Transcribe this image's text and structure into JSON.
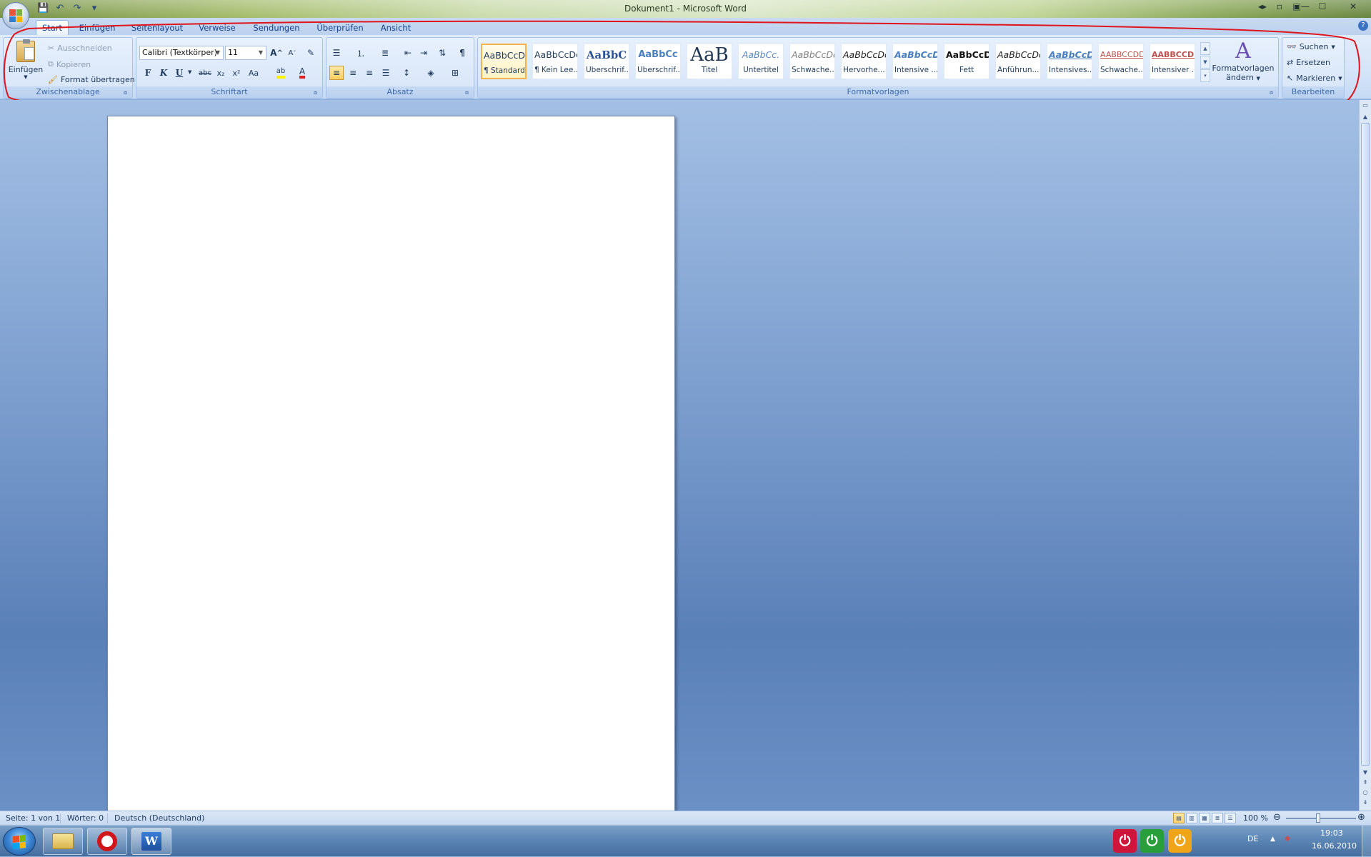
{
  "window": {
    "title": "Dokument1 - Microsoft Word"
  },
  "tabs": [
    {
      "label": "Start",
      "active": true
    },
    {
      "label": "Einfügen",
      "active": false
    },
    {
      "label": "Seitenlayout",
      "active": false
    },
    {
      "label": "Verweise",
      "active": false
    },
    {
      "label": "Sendungen",
      "active": false
    },
    {
      "label": "Überprüfen",
      "active": false
    },
    {
      "label": "Ansicht",
      "active": false
    }
  ],
  "clipboard": {
    "paste_label": "Einfügen",
    "cut_label": "Ausschneiden",
    "copy_label": "Kopieren",
    "format_painter_label": "Format übertragen",
    "group_label": "Zwischenablage"
  },
  "font": {
    "font_name": "Calibri (Textkörper)",
    "font_size": "11",
    "bold": "F",
    "italic": "K",
    "underline": "U",
    "strikethrough": "abc",
    "subscript": "x₂",
    "superscript": "x²",
    "case": "Aa",
    "grow": "A",
    "shrink": "A",
    "group_label": "Schriftart"
  },
  "paragraph": {
    "pilcrow": "¶",
    "group_label": "Absatz"
  },
  "styles": {
    "items": [
      {
        "sample": "AaBbCcDc",
        "name": "¶ Standard"
      },
      {
        "sample": "AaBbCcDc",
        "name": "¶ Kein Lee..."
      },
      {
        "sample": "AaBbC",
        "name": "Überschrif..."
      },
      {
        "sample": "AaBbCc",
        "name": "Überschrif..."
      },
      {
        "sample": "AaB",
        "name": "Titel"
      },
      {
        "sample": "AaBbCc.",
        "name": "Untertitel"
      },
      {
        "sample": "AaBbCcDc",
        "name": "Schwache..."
      },
      {
        "sample": "AaBbCcDc",
        "name": "Hervorhe..."
      },
      {
        "sample": "AaBbCcDc",
        "name": "Intensive ..."
      },
      {
        "sample": "AaBbCcDc",
        "name": "Fett"
      },
      {
        "sample": "AaBbCcDc",
        "name": "Anführun..."
      },
      {
        "sample": "AaBbCcDc",
        "name": "Intensives..."
      },
      {
        "sample": "AABBCCDD",
        "name": "Schwache..."
      },
      {
        "sample": "AABBCCDD",
        "name": "Intensiver ..."
      }
    ],
    "change_label_1": "Formatvorlagen",
    "change_label_2": "ändern",
    "group_label": "Formatvorlagen"
  },
  "editing": {
    "find_label": "Suchen",
    "replace_label": "Ersetzen",
    "select_label": "Markieren",
    "group_label": "Bearbeiten"
  },
  "status": {
    "page": "Seite: 1 von 1",
    "words": "Wörter: 0",
    "language": "Deutsch (Deutschland)",
    "zoom": "100 %"
  },
  "taskbar": {
    "lang": "DE",
    "time": "19:03",
    "date": "16.06.2010"
  },
  "colors": {
    "annotation": "#e0141b",
    "accent": "#15428b",
    "highlight": "#f3b34c"
  }
}
